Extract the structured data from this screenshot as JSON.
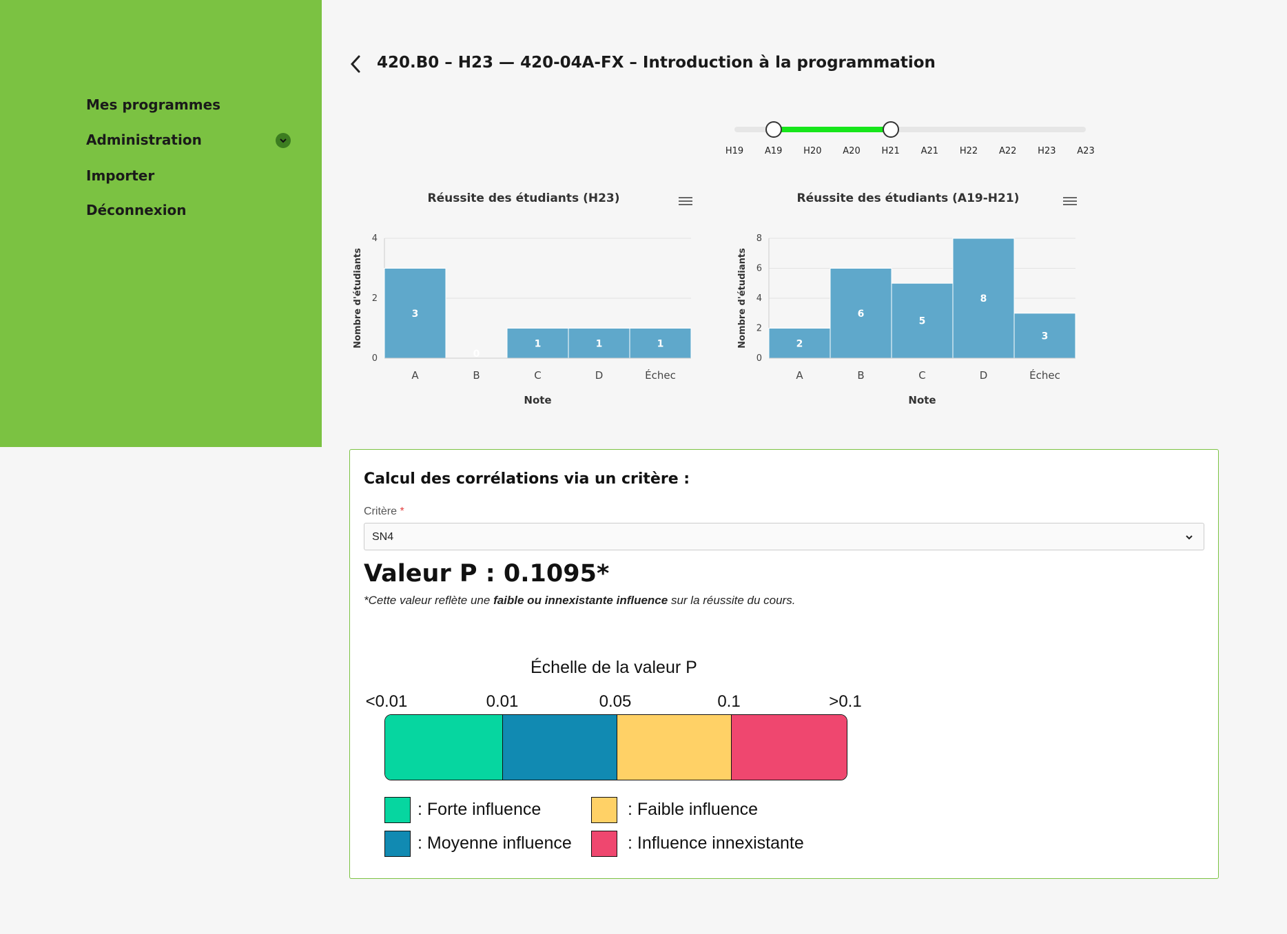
{
  "nav": {
    "items": [
      {
        "label": "Mes programmes"
      },
      {
        "label": "Administration"
      },
      {
        "label": "Importer"
      },
      {
        "label": "Déconnexion"
      }
    ]
  },
  "header": {
    "title": "420.B0 – H23 — 420-04A-FX – Introduction à la programmation"
  },
  "range_slider": {
    "ticks": [
      "H19",
      "A19",
      "H20",
      "A20",
      "H21",
      "A21",
      "H22",
      "A22",
      "H23",
      "A23"
    ],
    "selected_start": "A19",
    "selected_end": "H21",
    "colors": {
      "fill": "#17e61b",
      "track": "#e6e6e6"
    }
  },
  "chart_data": [
    {
      "type": "bar",
      "title": "Réussite des étudiants (H23)",
      "categories": [
        "A",
        "B",
        "C",
        "D",
        "Échec"
      ],
      "values": [
        3,
        0,
        1,
        1,
        1
      ],
      "xlabel": "Note",
      "ylabel": "Nombre d'étudiants",
      "ylim": [
        0,
        4
      ],
      "yticks": [
        "0",
        "2",
        "4"
      ],
      "grid": true,
      "color": "#5fa8cb"
    },
    {
      "type": "bar",
      "title": "Réussite des étudiants (A19-H21)",
      "categories": [
        "A",
        "B",
        "C",
        "D",
        "Échec"
      ],
      "values": [
        2,
        6,
        5,
        8,
        3
      ],
      "xlabel": "Note",
      "ylabel": "Nombre d'étudiants",
      "ylim": [
        0,
        8
      ],
      "yticks": [
        "0",
        "2",
        "4",
        "6",
        "8"
      ],
      "grid": true,
      "color": "#5fa8cb"
    }
  ],
  "correlation": {
    "title": "Calcul des corrélations via un critère :",
    "field_label": "Critère",
    "required_mark": "*",
    "selected_value": "SN4",
    "pvalue_text": "Valeur P : 0.1095*",
    "note_prefix": "*Cette valeur reflète une ",
    "note_bold": "faible ou innexistante influence",
    "note_suffix": " sur la réussite du cours.",
    "scale": {
      "title": "Échelle de la valeur P",
      "ticks": [
        "<0.01",
        "0.01",
        "0.05",
        "0.1",
        ">0.1"
      ],
      "colors": [
        "#06d6a0",
        "#118ab2",
        "#ffd166",
        "#ef476f"
      ]
    },
    "legend": [
      {
        "label": ": Forte influence",
        "color": "#06d6a0"
      },
      {
        "label": ": Faible influence",
        "color": "#ffd166"
      },
      {
        "label": ": Moyenne influence",
        "color": "#118ab2"
      },
      {
        "label": ": Influence innexistante",
        "color": "#ef476f"
      }
    ]
  },
  "theme": {
    "sidebar_bg": "#7bc242",
    "page_bg": "#f6f6f6",
    "card_border": "#7bc242"
  }
}
